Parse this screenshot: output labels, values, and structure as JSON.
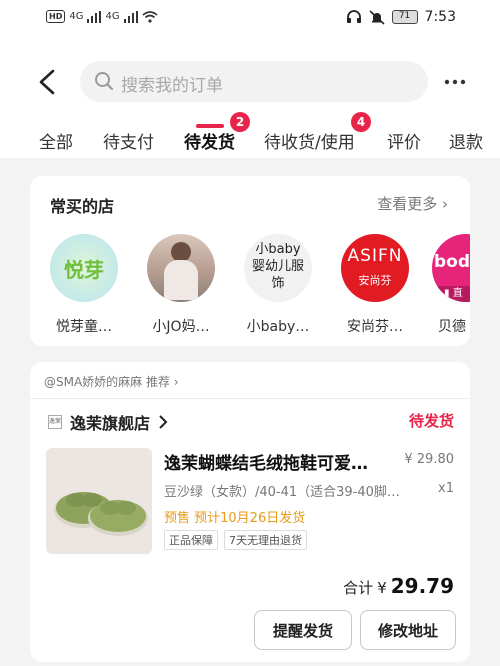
{
  "status_bar": {
    "left_badge": "HD",
    "network_a": "4G",
    "network_b": "4G",
    "battery": "71",
    "time": "7:53"
  },
  "search": {
    "placeholder": "搜索我的订单"
  },
  "tabs": [
    {
      "label": "全部"
    },
    {
      "label": "待支付"
    },
    {
      "label": "待发货",
      "badge": "2",
      "active": true
    },
    {
      "label": "待收货/使用",
      "badge": "4"
    },
    {
      "label": "评价"
    },
    {
      "label": "退款"
    }
  ],
  "frequent_stores": {
    "title": "常买的店",
    "see_more": "查看更多",
    "stores": [
      {
        "name": "悦芽童…",
        "avatar_text": "悦芽"
      },
      {
        "name": "小JO妈…"
      },
      {
        "name": "小baby…",
        "avatar_text": "小baby婴幼儿服饰"
      },
      {
        "name": "安尚芬…",
        "avatar_text_top": "ASIFN",
        "avatar_text_bottom": "安尚芬"
      },
      {
        "name": "贝德",
        "avatar_text_top": "bode",
        "avatar_badge": "直"
      }
    ]
  },
  "order": {
    "recommender": "@SMA娇娇的麻麻 推荐",
    "shop_name": "逸茉旗舰店",
    "shop_logo": "逸茉",
    "status": "待发货",
    "product": {
      "title": "逸茉蝴蝶结毛绒拖鞋可爱…",
      "price": "¥ 29.80",
      "spec": "豆沙绿（女款）/40-41（适合39-40脚…",
      "qty": "x1",
      "presale": "预售 预计10月26日发货",
      "tags": [
        "正品保障",
        "7天无理由退货"
      ]
    },
    "total_label": "合计",
    "total_currency": "¥",
    "total_amount": "29.79",
    "buttons": {
      "remind": "提醒发货",
      "change_address": "修改地址"
    }
  },
  "colors": {
    "accent": "#e8244a",
    "presale": "#e89a1a"
  }
}
